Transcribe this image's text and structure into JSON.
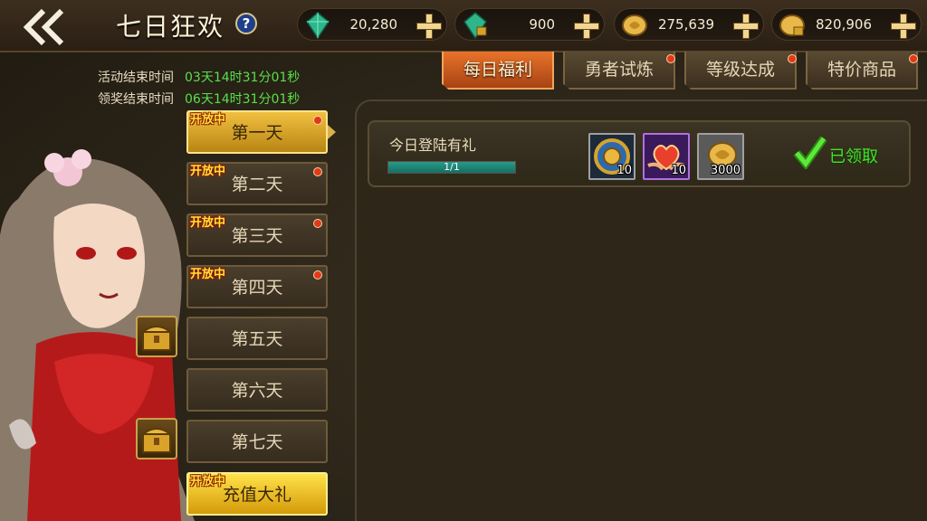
{
  "header": {
    "title": "七日狂欢",
    "help": "?"
  },
  "currencies": [
    {
      "icon": "green-gem-icon",
      "value": "20,280"
    },
    {
      "icon": "locked-green-gem-icon",
      "value": "900"
    },
    {
      "icon": "gold-coin-icon",
      "value": "275,639"
    },
    {
      "icon": "locked-gold-coin-icon",
      "value": "820,906"
    }
  ],
  "timers": {
    "activity_end_label": "活动结束时间",
    "activity_end_value": "03天14时31分01秒",
    "claim_end_label": "领奖结束时间",
    "claim_end_value": "06天14时31分01秒"
  },
  "tabs": [
    {
      "label": "每日福利",
      "active": true
    },
    {
      "label": "勇者试炼",
      "active": false
    },
    {
      "label": "等级达成",
      "active": false
    },
    {
      "label": "特价商品",
      "active": false
    }
  ],
  "days": [
    {
      "label": "第一天",
      "badge": "开放中"
    },
    {
      "label": "第二天",
      "badge": "开放中"
    },
    {
      "label": "第三天",
      "badge": "开放中"
    },
    {
      "label": "第四天",
      "badge": "开放中"
    },
    {
      "label": "第五天",
      "badge": ""
    },
    {
      "label": "第六天",
      "badge": ""
    },
    {
      "label": "第七天",
      "badge": ""
    },
    {
      "label": "充值大礼",
      "badge": "开放中"
    }
  ],
  "reward": {
    "title": "今日登陆有礼",
    "progress_text": "1/1",
    "progress_fraction": 1.0,
    "items": [
      {
        "icon": "gold-token-icon",
        "qty": "10"
      },
      {
        "icon": "heart-hands-icon",
        "qty": "10"
      },
      {
        "icon": "gold-coins-icon",
        "qty": "3000"
      }
    ],
    "status": "已领取"
  },
  "colors": {
    "accent_tab": "#e8732a",
    "timer_value": "#58e04a",
    "claimed": "#4adf2e",
    "badge_red": "#e03a18"
  }
}
